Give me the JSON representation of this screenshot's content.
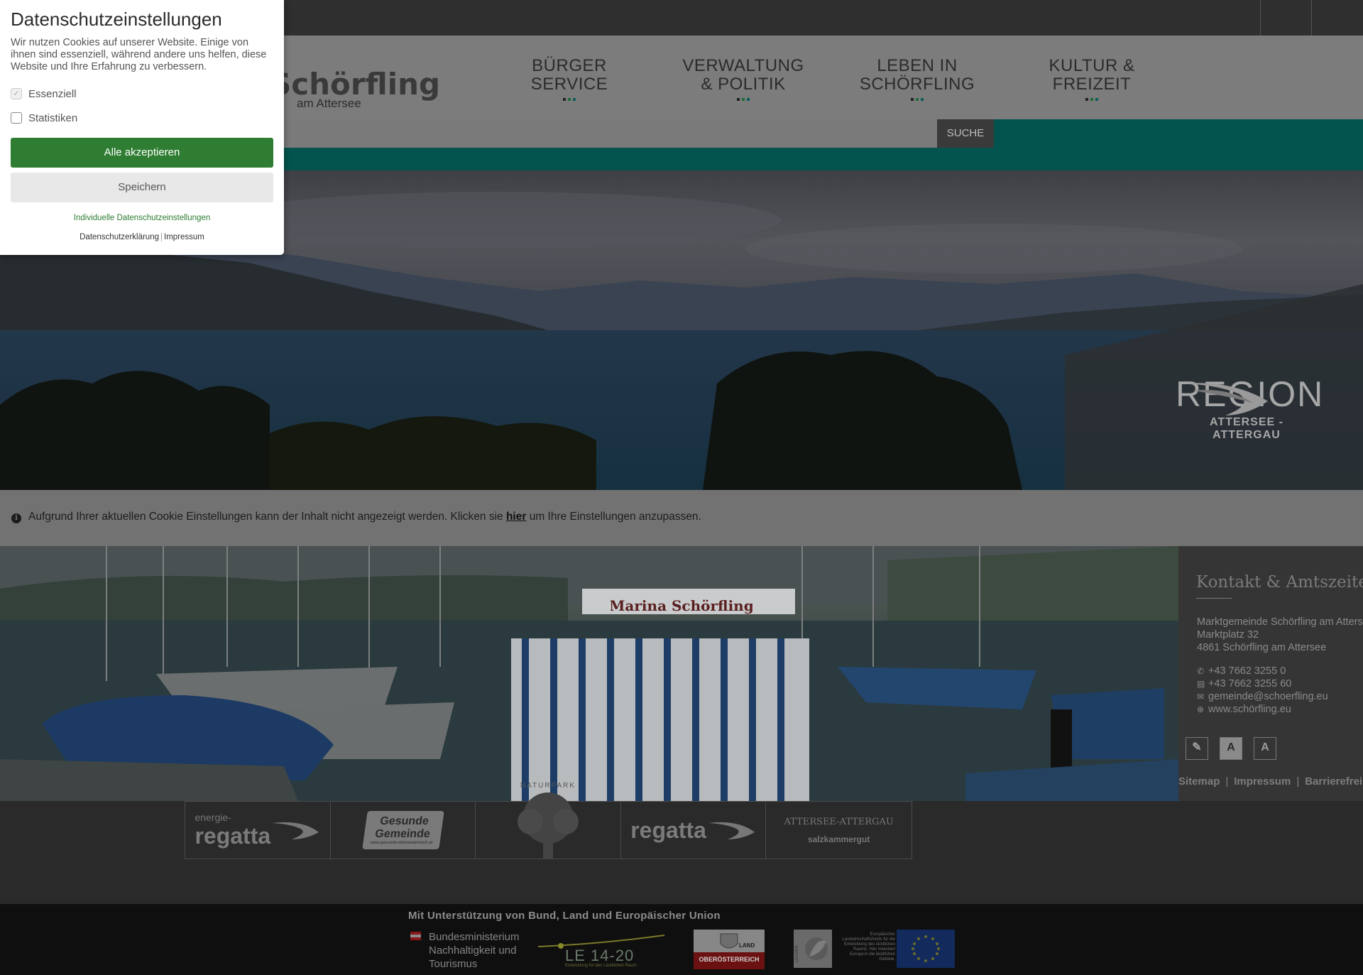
{
  "header": {
    "logo_name": "Schörfling",
    "logo_sub": "am Attersee",
    "nav": [
      {
        "line1": "BÜRGER",
        "line2": "SERVICE"
      },
      {
        "line1": "VERWALTUNG",
        "line2": "& POLITIK"
      },
      {
        "line1": "LEBEN IN",
        "line2": "SCHÖRFLING"
      },
      {
        "line1": "KULTUR &",
        "line2": "FREIZEIT"
      }
    ],
    "search_button": "SUCHE"
  },
  "hero": {
    "region_title": "REGION",
    "region_sub": "ATTERSEE - ATTERGAU"
  },
  "notice": {
    "text_before": "Aufgrund Ihrer aktuellen Cookie Einstellungen kann der Inhalt nicht angezeigt werden. Klicken sie ",
    "link": "hier",
    "text_after": " um Ihre Einstellungen anzupassen."
  },
  "marina": {
    "sign": "Marina Schörfling"
  },
  "contact": {
    "title": "Kontakt & Amtszeiten",
    "address_line1": "Marktgemeinde Schörfling am Attersee",
    "address_line2": "Marktplatz 32",
    "address_line3": "4861 Schörfling am Attersee",
    "phone": "+43 7662 3255 0",
    "fax": "+43 7662 3255 60",
    "email": "gemeinde@schoerfling.eu",
    "web": "www.schörfling.eu",
    "tools": [
      "A",
      "A"
    ]
  },
  "footer_links": [
    "Sitemap",
    "Impressum",
    "Barrierefreiheit"
  ],
  "partners": [
    {
      "top": "energie-",
      "main": "regatta"
    },
    {
      "top": "Gesunde",
      "main": "Gemeinde",
      "url": "www.gesunde-oberoesterreich.at"
    },
    {
      "top": "NATURPARK",
      "main": ""
    },
    {
      "top": "",
      "main": "regatta"
    },
    {
      "top": "ATTERSEE-ATTERGAU",
      "main": "salzkammergut"
    }
  ],
  "funding": {
    "title": "Mit Unterstützung von Bund, Land und Europäischer Union",
    "ministry_line1": "Bundesministerium",
    "ministry_line2": "Nachhaltigkeit und",
    "ministry_line3": "Tourismus",
    "le_label": "LE 14-20",
    "le_sub": "Entwicklung für den Ländlichen Raum",
    "land_label": "LAND",
    "ooe_label": "OBERÖSTERREICH",
    "leader_label": "LEADER",
    "eu_text": "Europäischer Landwirtschaftsfonds für die Entwicklung des ländlichen Raums: Hier investiert Europa in die ländlichen Gebiete."
  },
  "cookie_modal": {
    "title": "Datenschutzeinstellungen",
    "description": "Wir nutzen Cookies auf unserer Website. Einige von ihnen sind essenziell, während andere uns helfen, diese Website und Ihre Erfahrung zu verbessern.",
    "options": [
      {
        "label": "Essenziell",
        "checked": true,
        "disabled": true
      },
      {
        "label": "Statistiken",
        "checked": false,
        "disabled": false
      }
    ],
    "accept_all": "Alle akzeptieren",
    "save": "Speichern",
    "individual": "Individuelle Datenschutzeinstellungen",
    "privacy": "Datenschutzerklärung",
    "imprint": "Impressum"
  },
  "colors": {
    "accent_green": "#2e7d32",
    "teal": "#03544f",
    "overlay_dark": "#2f2f2f"
  }
}
